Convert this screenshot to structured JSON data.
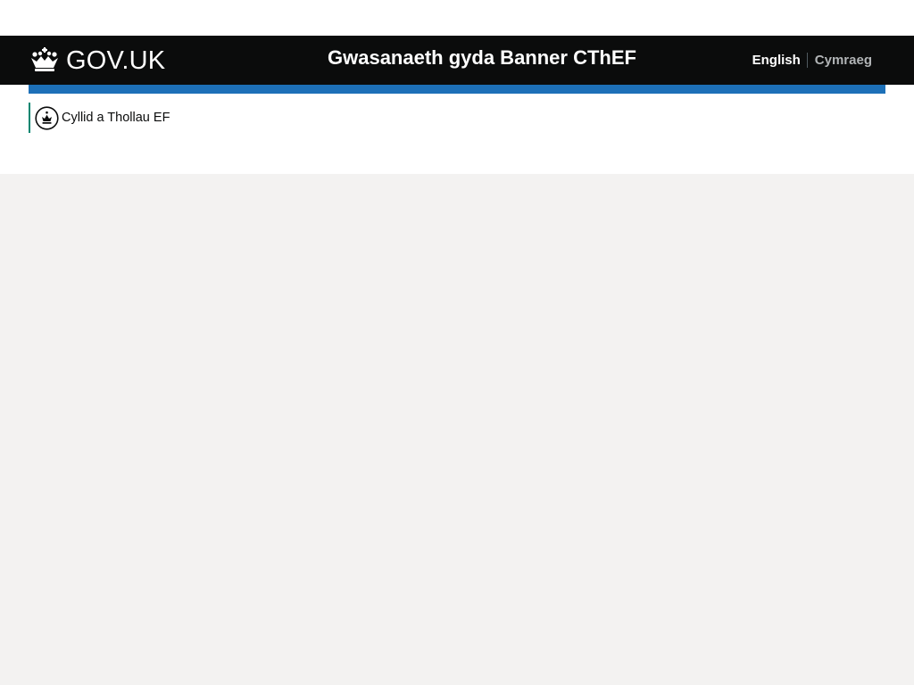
{
  "header": {
    "logo_text": "GOV.UK",
    "logo_icon": "crown-icon",
    "service_name": "Gwasanaeth gyda Banner CThEF"
  },
  "language_toggle": {
    "current": "English",
    "alternate": "Cymraeg"
  },
  "organisation_banner": {
    "icon": "hmrc-crest-icon",
    "name": "Cyllid a Thollau EF"
  },
  "colors": {
    "header_background": "#0b0c0c",
    "accent_bar": "#1d70b8",
    "organisation_border": "#008670",
    "page_background": "#f3f2f1"
  }
}
